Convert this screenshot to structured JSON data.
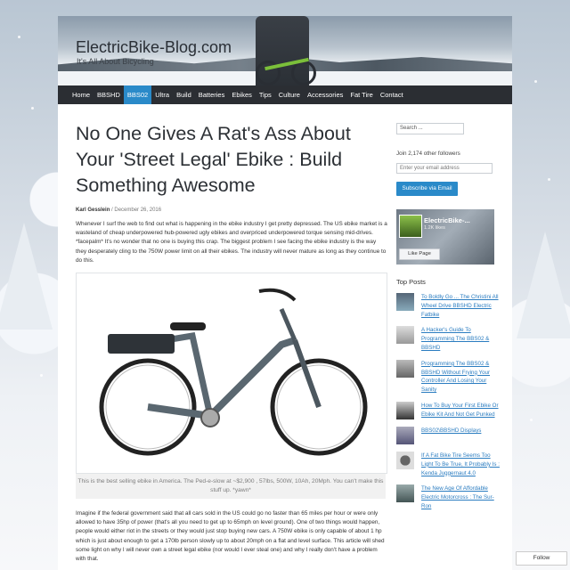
{
  "site": {
    "title": "ElectricBike-Blog.com",
    "tagline": "It's All About Bicycling"
  },
  "nav": {
    "items": [
      "Home",
      "BBSHD",
      "BBS02",
      "Ultra",
      "Build",
      "Batteries",
      "Ebikes",
      "Tips",
      "Culture",
      "Accessories",
      "Fat Tire",
      "Contact"
    ],
    "active": "BBS02"
  },
  "post": {
    "title": "No One Gives A Rat's Ass About Your 'Street Legal' Ebike : Build Something Awesome",
    "author": "Karl Gesslein",
    "separator": "/",
    "date": "December 26, 2016",
    "para1": "Whenever I surf the web to find out what is happening in the ebike industry I get pretty depressed. The US ebike market is a wasteland of cheap underpowered hub-powered ugly ebikes and overpriced underpowered torque sensing mid-drives. *facepalm* It's no wonder that no one is buying this crap. The biggest problem I see facing the ebike industry is the way they desperately cling to the 750W power limit on all their ebikes. The industry will never mature as long as they continue to do this.",
    "caption": "This is the best selling ebike in America. The Ped-e-slow at ~$2,900 , 57lbs, 500W, 10Ah, 20Mph. You can't make this stuff up. *yawn*",
    "para2": "Imagine if the federal government said that all cars sold in the US could go no faster than 65 miles per hour or were only allowed to have 35hp of power (that's all you need to get up to 65mph on level ground). One of two things would happen, people would either riot in the streets or they would just stop buying new cars. A 750W ebike is only capable of about 1 hp which is just about enough to get a 170lb person slowly up to about 20mph on a flat and level surface. This article will shed some light on why I will never own a street legal ebike (nor would I ever steal one) and why I really don't have a problem with that."
  },
  "sidebar": {
    "search_placeholder": "Search ...",
    "followers": "Join 2,174 other followers",
    "email_placeholder": "Enter your email address",
    "subscribe": "Subscribe via Email",
    "fb_name": "ElectricBike-...",
    "fb_likes": "1.2K likes",
    "fb_like_btn": "Like Page",
    "top_posts_title": "Top Posts",
    "top_posts": [
      "To Boldly Go ... The Christini All Wheel Drive BBSHD Electric Fatbike",
      "A Hacker's Guide To Programming The BBS02 & BBSHD",
      "Programming The BBS02 & BBSHD Without Frying Your Controller And Losing Your Sanity",
      "How To Buy Your First Ebike Or Ebike Kit And Not Get Punked",
      "BBS02\\BBSHD Displays",
      "If A Fat Bike Tire Seems Too Light To Be True, It Probably Is : Kenda Juggernaut 4.0",
      "The New Age Of Affordable Electric Motorcross : The Sur-Ron"
    ]
  },
  "follow_button": "Follow",
  "colors": {
    "nav_bg": "#2b2e33",
    "accent": "#2a8ac9",
    "link": "#2a7cc0"
  }
}
